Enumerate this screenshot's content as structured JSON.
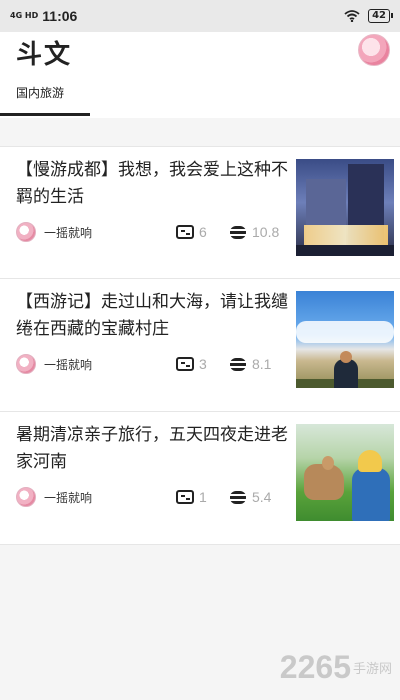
{
  "status_bar": {
    "network": "4G HD",
    "time": "11:06",
    "battery": "42",
    "icons": [
      "wifi-icon",
      "battery-icon"
    ]
  },
  "header": {
    "app_title": "斗文",
    "tabs": [
      {
        "label": "国内旅游",
        "active": true
      }
    ]
  },
  "articles": [
    {
      "title": "【慢游成都】我想，我会爱上这种不羁的生活",
      "author": "一摇就响",
      "comments": "6",
      "coins": "10.8",
      "image": "city-night-photo"
    },
    {
      "title": "【西游记】走过山和大海，请让我缱绻在西藏的宝藏村庄",
      "author": "一摇就响",
      "comments": "3",
      "coins": "8.1",
      "image": "grassland-sky-photo"
    },
    {
      "title": "暑期清凉亲子旅行，五天四夜走进老家河南",
      "author": "一摇就响",
      "comments": "1",
      "coins": "5.4",
      "image": "child-deer-photo"
    }
  ],
  "watermark": {
    "number": "2265",
    "text": "手游网"
  }
}
